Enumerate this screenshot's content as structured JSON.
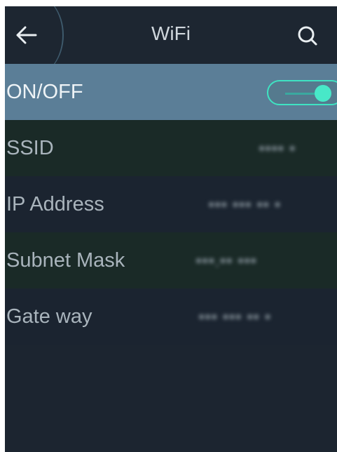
{
  "header": {
    "title": "WiFi",
    "back_icon": "arrow-left-icon",
    "search_icon": "search-icon"
  },
  "settings": {
    "onoff": {
      "label": "ON/OFF",
      "enabled": true
    },
    "rows": [
      {
        "label": "SSID",
        "value": "•••• •"
      },
      {
        "label": "IP Address",
        "value": "••• ••• •• •"
      },
      {
        "label": "Subnet Mask",
        "value": "•••.•• •••"
      },
      {
        "label": "Gate way",
        "value": "••• ••• •• •"
      }
    ]
  },
  "colors": {
    "accent": "#48e8c8",
    "selected_row": "#5b7e97",
    "background": "#1c2530"
  }
}
